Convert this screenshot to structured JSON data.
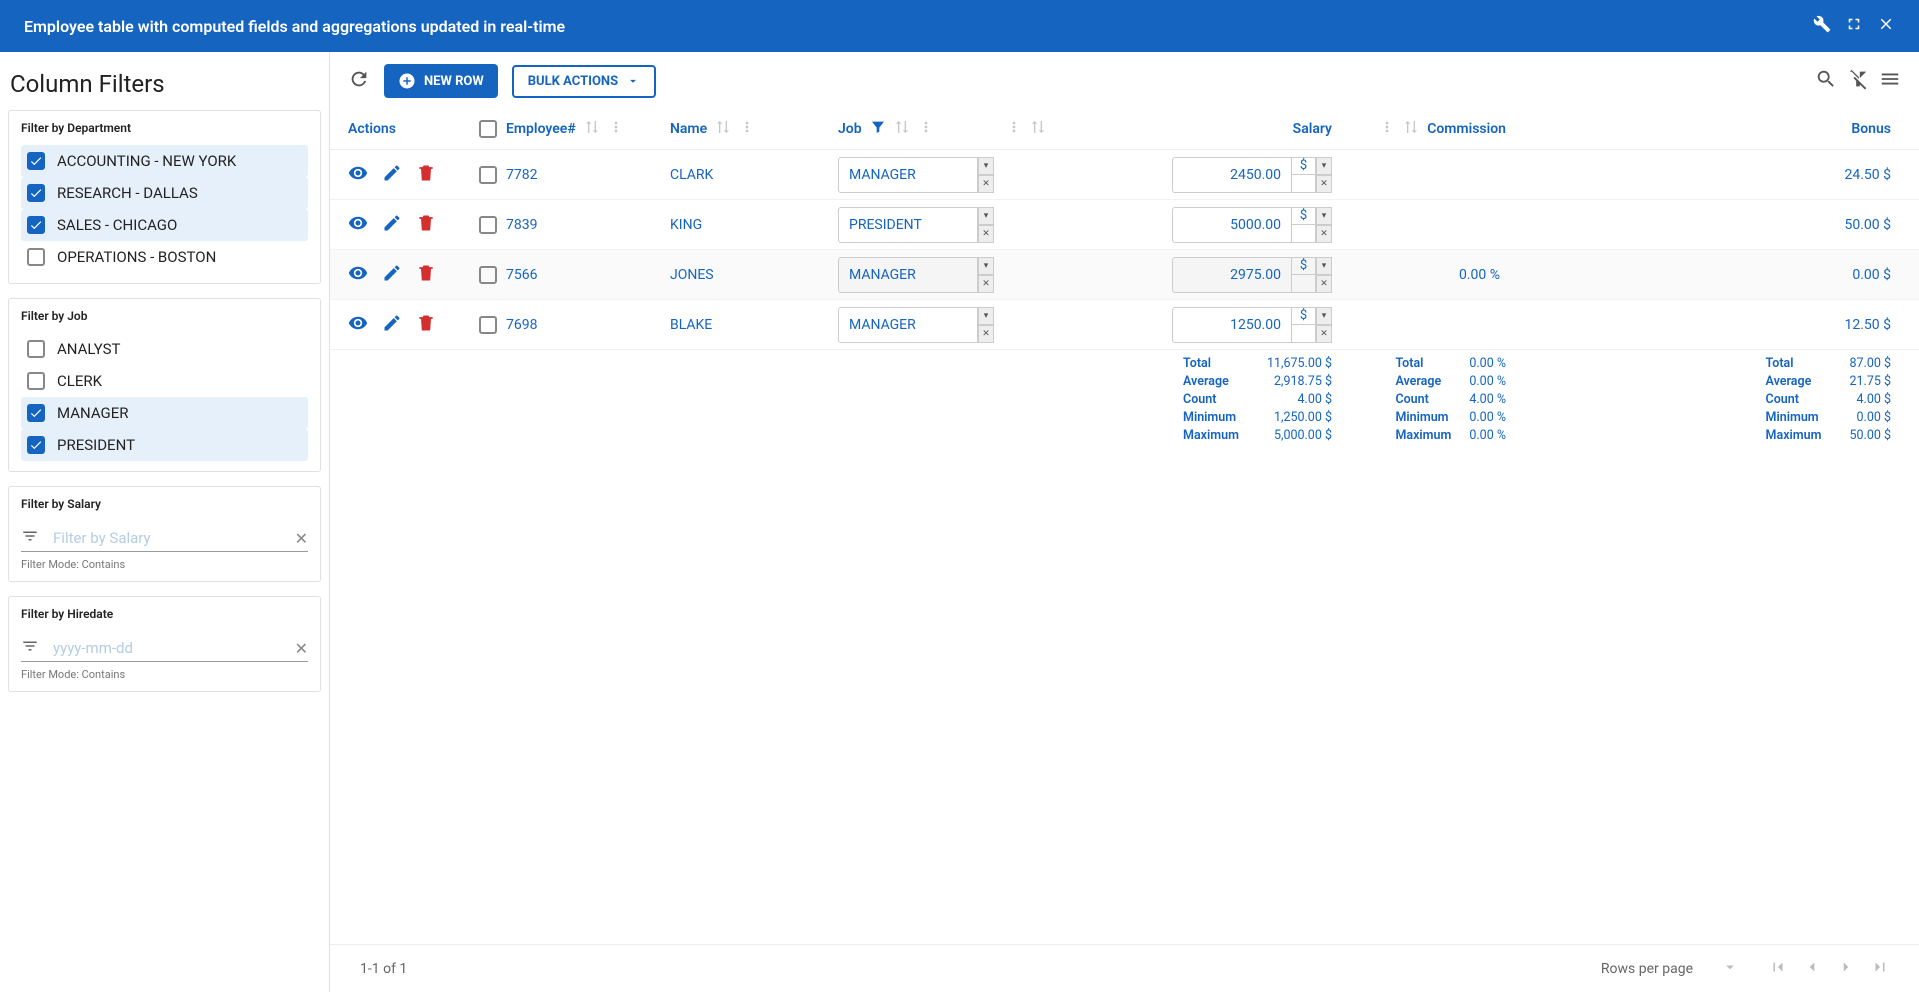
{
  "header": {
    "title": "Employee table with computed fields and aggregations updated in real-time"
  },
  "sidebar": {
    "title": "Column Filters",
    "dept": {
      "title": "Filter by Department",
      "items": [
        {
          "label": "ACCOUNTING - NEW YORK",
          "checked": true
        },
        {
          "label": "RESEARCH - DALLAS",
          "checked": true
        },
        {
          "label": "SALES - CHICAGO",
          "checked": true
        },
        {
          "label": "OPERATIONS - BOSTON",
          "checked": false
        }
      ]
    },
    "job": {
      "title": "Filter by Job",
      "items": [
        {
          "label": "ANALYST",
          "checked": false
        },
        {
          "label": "CLERK",
          "checked": false
        },
        {
          "label": "MANAGER",
          "checked": true
        },
        {
          "label": "PRESIDENT",
          "checked": true
        }
      ]
    },
    "salary": {
      "title": "Filter by Salary",
      "placeholder": "Filter by Salary",
      "mode": "Filter Mode: Contains"
    },
    "hiredate": {
      "title": "Filter by Hiredate",
      "placeholder": "yyyy-mm-dd",
      "mode": "Filter Mode: Contains"
    }
  },
  "toolbar": {
    "new_row": "NEW ROW",
    "bulk": "BULK ACTIONS"
  },
  "columns": {
    "actions": "Actions",
    "employee": "Employee#",
    "name": "Name",
    "job": "Job",
    "salary": "Salary",
    "commission": "Commission",
    "bonus": "Bonus"
  },
  "rows": [
    {
      "emp": "7782",
      "name": "CLARK",
      "job": "MANAGER",
      "salary": "2450.00",
      "commission": "",
      "bonus": "24.50 $",
      "alt": false
    },
    {
      "emp": "7839",
      "name": "KING",
      "job": "PRESIDENT",
      "salary": "5000.00",
      "commission": "",
      "bonus": "50.00 $",
      "alt": false
    },
    {
      "emp": "7566",
      "name": "JONES",
      "job": "MANAGER",
      "salary": "2975.00",
      "commission": "0.00 %",
      "bonus": "0.00 $",
      "alt": true
    },
    {
      "emp": "7698",
      "name": "BLAKE",
      "job": "MANAGER",
      "salary": "1250.00",
      "commission": "",
      "bonus": "12.50 $",
      "alt": false
    }
  ],
  "agg": {
    "labels": [
      "Total",
      "Average",
      "Count",
      "Minimum",
      "Maximum"
    ],
    "salary": [
      "11,675.00 $",
      "2,918.75 $",
      "4.00 $",
      "1,250.00 $",
      "5,000.00 $"
    ],
    "commission": [
      "0.00 %",
      "0.00 %",
      "4.00 %",
      "0.00 %",
      "0.00 %"
    ],
    "bonus": [
      "87.00 $",
      "21.75 $",
      "4.00 $",
      "0.00 $",
      "50.00 $"
    ]
  },
  "footer": {
    "range": "1-1 of 1",
    "rows_per_page": "Rows per page"
  },
  "currency": "$"
}
